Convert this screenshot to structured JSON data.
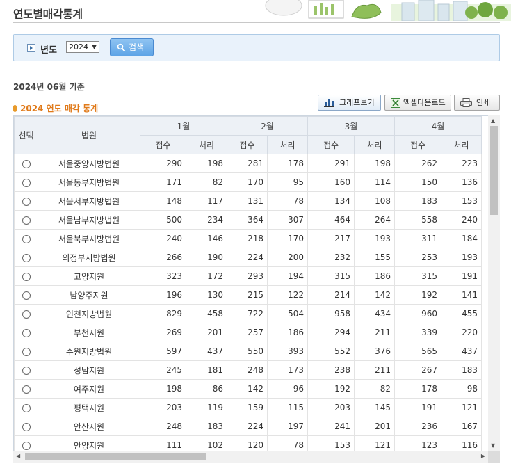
{
  "page_title": "연도별매각통계",
  "search": {
    "year_label": "년도",
    "year_value": "2024",
    "search_button": "검색"
  },
  "base_date": "2024년 06월 기준",
  "section_title": "2024 연도 매각 통계",
  "toolbar": {
    "graph_label": "그래프보기",
    "excel_label": "엑셀다운로드",
    "print_label": "인쇄"
  },
  "table": {
    "col_select": "선택",
    "col_court": "법원",
    "months": [
      "1월",
      "2월",
      "3월",
      "4월"
    ],
    "sub_receipt": "접수",
    "sub_process": "처리",
    "rows": [
      {
        "court": "서울중앙지방법원",
        "values": [
          "290",
          "198",
          "281",
          "178",
          "291",
          "198",
          "262",
          "223"
        ]
      },
      {
        "court": "서울동부지방법원",
        "values": [
          "171",
          "82",
          "170",
          "95",
          "160",
          "114",
          "150",
          "136"
        ]
      },
      {
        "court": "서울서부지방법원",
        "values": [
          "148",
          "117",
          "131",
          "78",
          "134",
          "108",
          "183",
          "153"
        ]
      },
      {
        "court": "서울남부지방법원",
        "values": [
          "500",
          "234",
          "364",
          "307",
          "464",
          "264",
          "558",
          "240"
        ]
      },
      {
        "court": "서울북부지방법원",
        "values": [
          "240",
          "146",
          "218",
          "170",
          "217",
          "193",
          "311",
          "184"
        ]
      },
      {
        "court": "의정부지방법원",
        "values": [
          "266",
          "190",
          "224",
          "200",
          "232",
          "155",
          "253",
          "193"
        ]
      },
      {
        "court": "고양지원",
        "values": [
          "323",
          "172",
          "293",
          "194",
          "315",
          "186",
          "315",
          "191"
        ]
      },
      {
        "court": "남양주지원",
        "values": [
          "196",
          "130",
          "215",
          "122",
          "214",
          "142",
          "192",
          "141"
        ]
      },
      {
        "court": "인천지방법원",
        "values": [
          "829",
          "458",
          "722",
          "504",
          "958",
          "434",
          "960",
          "455"
        ]
      },
      {
        "court": "부천지원",
        "values": [
          "269",
          "201",
          "257",
          "186",
          "294",
          "211",
          "339",
          "220"
        ]
      },
      {
        "court": "수원지방법원",
        "values": [
          "597",
          "437",
          "550",
          "393",
          "552",
          "376",
          "565",
          "437"
        ]
      },
      {
        "court": "성남지원",
        "values": [
          "245",
          "181",
          "248",
          "173",
          "238",
          "211",
          "267",
          "183"
        ]
      },
      {
        "court": "여주지원",
        "values": [
          "198",
          "86",
          "142",
          "96",
          "192",
          "82",
          "178",
          "98"
        ]
      },
      {
        "court": "평택지원",
        "values": [
          "203",
          "119",
          "159",
          "115",
          "203",
          "145",
          "191",
          "121"
        ]
      },
      {
        "court": "안산지원",
        "values": [
          "248",
          "183",
          "224",
          "197",
          "241",
          "201",
          "236",
          "167"
        ]
      },
      {
        "court": "안양지원",
        "values": [
          "111",
          "102",
          "120",
          "78",
          "153",
          "121",
          "123",
          "116"
        ]
      }
    ]
  }
}
